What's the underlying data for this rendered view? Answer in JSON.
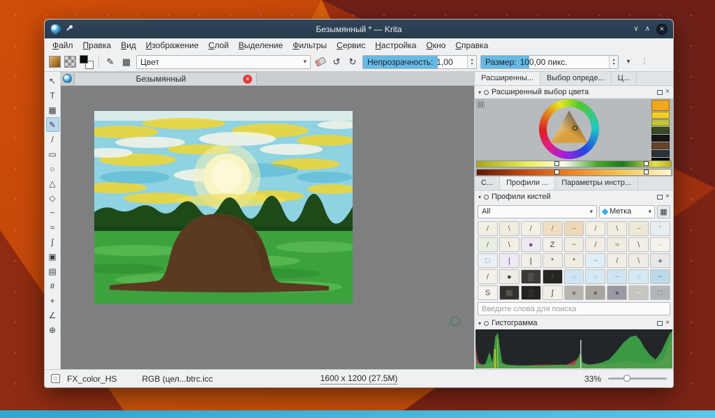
{
  "window": {
    "title": "Безымянный * — Krita",
    "controls": {
      "shade_icon": "∨",
      "unshade_icon": "∧",
      "close_icon": "×"
    }
  },
  "menu": {
    "items": [
      "Файл",
      "Правка",
      "Вид",
      "Изображение",
      "Слой",
      "Выделение",
      "Фильтры",
      "Сервис",
      "Настройка",
      "Окно",
      "Справка"
    ]
  },
  "toolbar": {
    "blend_mode": "Цвет",
    "opacity_label": "Непрозрачность:",
    "opacity_value": "1,00",
    "size_label": "Размер:",
    "size_value": "100,00 пикс.",
    "icons": {
      "grid": "▦",
      "tool": "✎",
      "undo": "↺",
      "redo": "↻",
      "caret": "▾",
      "overflow": "⋮",
      "spin_up": "▴",
      "spin_down": "▾"
    }
  },
  "toolbox": {
    "tools": [
      {
        "name": "select-shapes-tool",
        "glyph": "↖",
        "active": false
      },
      {
        "name": "text-tool",
        "glyph": "T",
        "active": false
      },
      {
        "name": "edit-shapes-tool",
        "glyph": "▦",
        "active": false
      },
      {
        "name": "freehand-brush-tool",
        "glyph": "✎",
        "active": true
      },
      {
        "name": "line-tool",
        "glyph": "/",
        "active": false
      },
      {
        "name": "rectangle-tool",
        "glyph": "▭",
        "active": false
      },
      {
        "name": "ellipse-tool",
        "glyph": "○",
        "active": false
      },
      {
        "name": "polygon-tool",
        "glyph": "△",
        "active": false
      },
      {
        "name": "polyline-tool",
        "glyph": "◇",
        "active": false
      },
      {
        "name": "bezier-curve-tool",
        "glyph": "~",
        "active": false
      },
      {
        "name": "freehand-path-tool",
        "glyph": "≈",
        "active": false
      },
      {
        "name": "dynamic-brush-tool",
        "glyph": "∫",
        "active": false
      },
      {
        "name": "fill-tool",
        "glyph": "▣",
        "active": false
      },
      {
        "name": "gradient-tool",
        "glyph": "▤",
        "active": false
      },
      {
        "name": "crop-tool",
        "glyph": "#",
        "active": false
      },
      {
        "name": "move-tool",
        "glyph": "+",
        "active": false
      },
      {
        "name": "measure-tool",
        "glyph": "∠",
        "active": false
      },
      {
        "name": "color-picker-tool",
        "glyph": "⊕",
        "active": false
      }
    ]
  },
  "canvas": {
    "tab_title": "Безымянный",
    "close_icon": "×"
  },
  "dockers": {
    "top_tabs": [
      {
        "label": "Расширенны...",
        "active": true
      },
      {
        "label": "Выбор опреде...",
        "active": false
      },
      {
        "label": "Ц...",
        "active": false
      }
    ],
    "color_selector": {
      "title": "Расширенный выбор цвета",
      "history_colors": [
        "#f0a81e",
        "#f0d028",
        "#c2c43a",
        "#3a4a22",
        "#161616",
        "#6a4426",
        "#28323a",
        "#0a0a0a"
      ]
    },
    "mid_tabs": [
      {
        "label": "С...",
        "active": false
      },
      {
        "label": "Профили ...",
        "active": true
      },
      {
        "label": "Параметры инстр...",
        "active": false
      }
    ],
    "brush_presets": {
      "title": "Профили кистей",
      "filter_value": "All",
      "tag_label": "Метка",
      "search_placeholder": "Введите слова для поиска",
      "cells": [
        [
          "#f2efe4",
          "/",
          "#6b6257"
        ],
        [
          "#f0ece0",
          "\\",
          "#756a5c"
        ],
        [
          "#f4f0e6",
          "/",
          "#5f564c"
        ],
        [
          "#eedec2",
          "/",
          "#a8743c"
        ],
        [
          "#ecd9b8",
          "~",
          "#b07a3a"
        ],
        [
          "#f3efe5",
          "/",
          "#6f675b"
        ],
        [
          "#f1ede1",
          "\\",
          "#686055"
        ],
        [
          "#efe8d6",
          "~",
          "#8a7c64"
        ],
        [
          "#e7edf1",
          "°",
          "#9fb4c2"
        ],
        [
          "#e9efe2",
          "/",
          "#4e7a3a"
        ],
        [
          "#f2efe6",
          "\\",
          "#55504a"
        ],
        [
          "#efeaf2",
          "●",
          "#7a4a9a"
        ],
        [
          "#f3f0e8",
          "Z",
          "#3a3a3a"
        ],
        [
          "#f1ede3",
          "~",
          "#6a5f52"
        ],
        [
          "#f2eee5",
          "/",
          "#5c564e"
        ],
        [
          "#f0ece2",
          "≈",
          "#6e675c"
        ],
        [
          "#f3efe6",
          "\\",
          "#565048"
        ],
        [
          "#f6f3ec",
          "·",
          "#c04040"
        ],
        [
          "#eaf0f4",
          "□",
          "#7a92a6"
        ],
        [
          "#efe9f4",
          "|",
          "#6a3a9a"
        ],
        [
          "#f2efe8",
          "|",
          "#2e2a28"
        ],
        [
          "#f1ede4",
          "*",
          "#4a443c"
        ],
        [
          "#f0ece1",
          "*",
          "#5a5248"
        ],
        [
          "#e2eef6",
          "~",
          "#5a9ec8"
        ],
        [
          "#f2eee5",
          "/",
          "#605a50"
        ],
        [
          "#f0ece3",
          "\\",
          "#6a6258"
        ],
        [
          "#e8e8e8",
          "●",
          "#8a8a8a"
        ],
        [
          "#f3f0e9",
          "/",
          "#56504a"
        ],
        [
          "#efece4",
          "●",
          "#46413c"
        ],
        [
          "#3c3a36",
          "▒",
          "#8a8680"
        ],
        [
          "#26241f",
          "/",
          "#5a564e"
        ],
        [
          "#cfe6f2",
          "○",
          "#7ab0cc"
        ],
        [
          "#d4e9f4",
          "○",
          "#86b8d4"
        ],
        [
          "#cfe5f1",
          "~",
          "#6aa8c8"
        ],
        [
          "#d6eaf5",
          "○",
          "#88bad6"
        ],
        [
          "#bcd8ea",
          "~",
          "#5888a8"
        ],
        [
          "#f4f2ec",
          "S",
          "#4a443e"
        ],
        [
          "#32302c",
          "▦",
          "#6a6660"
        ],
        [
          "#242220",
          "▒",
          "#565249"
        ],
        [
          "#f2efe8",
          "∫",
          "#3c3834"
        ],
        [
          "#b8b4ae",
          "●",
          "#7c7870"
        ],
        [
          "#a8a49e",
          "●",
          "#6e6a62"
        ],
        [
          "#9c98a2",
          "●",
          "#645f68"
        ],
        [
          "#c8c4be",
          "~",
          "#ffffff"
        ],
        [
          "#b0b6ba",
          "□",
          "#707678"
        ]
      ]
    },
    "histogram": {
      "title": "Гистограмма"
    }
  },
  "statusbar": {
    "gradient_name": "FX_color_HS",
    "color_profile": "RGB (цел...btrc.icc",
    "image_size": "1600 x 1200 (27.5M)",
    "zoom": "33%"
  },
  "ui_icons": {
    "collapse": "▾",
    "close": "×",
    "settings": "▤"
  }
}
